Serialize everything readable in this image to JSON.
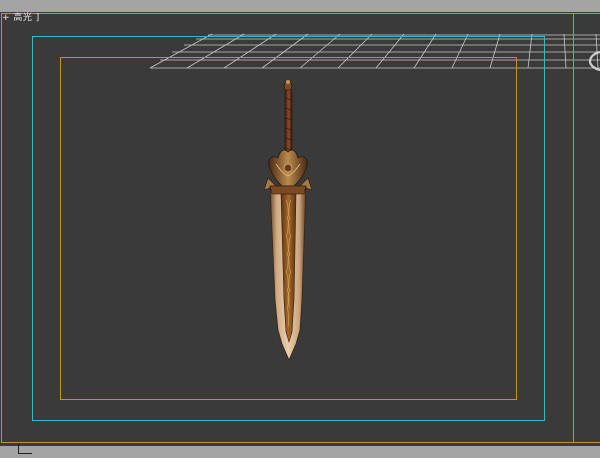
{
  "viewport": {
    "label": "+ 高光 ]",
    "colors": {
      "background": "#3a3a3a",
      "chrome": "#a4a4a4",
      "safe_frame": "#b69a25",
      "action_safe": "#36b8c4",
      "grid": "#d8d8d8"
    }
  },
  "icons": {
    "viewcube": "orbit-ring-icon",
    "corner": "viewport-corner-icon"
  }
}
